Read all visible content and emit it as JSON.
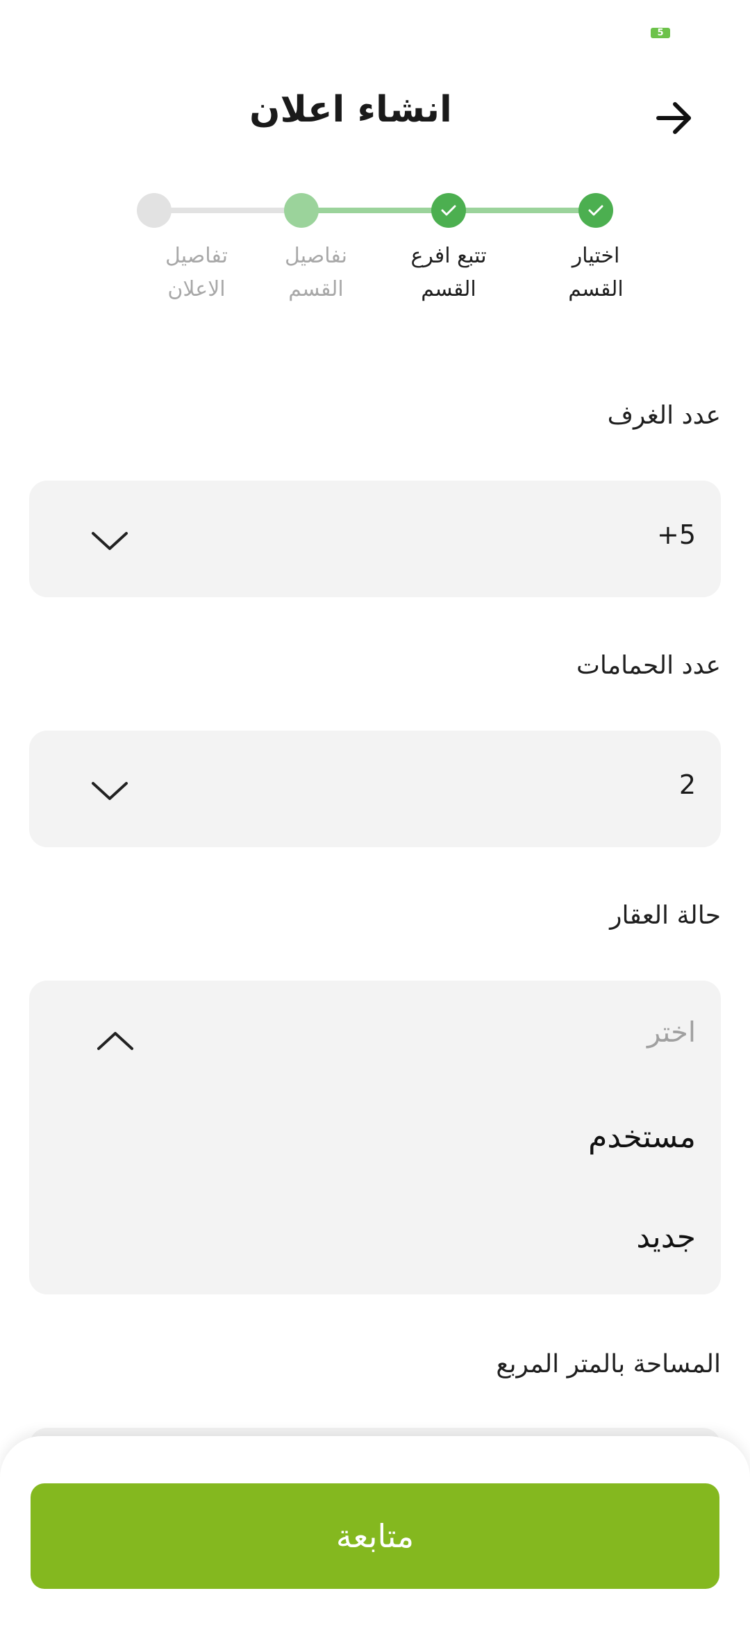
{
  "status_bar": {
    "battery": "5"
  },
  "header": {
    "title": "انشاء اعلان"
  },
  "stepper": {
    "steps": [
      {
        "line1": "اختيار",
        "line2": "القسم",
        "state": "done"
      },
      {
        "line1": "تتبع افرع",
        "line2": "القسم",
        "state": "done"
      },
      {
        "line1": "نفاصيل",
        "line2": "القسم",
        "state": "current"
      },
      {
        "line1": "تفاصيل",
        "line2": "الاعلان",
        "state": "pending"
      }
    ]
  },
  "form": {
    "rooms": {
      "label": "عدد الغرف",
      "value": "5+"
    },
    "bathrooms": {
      "label": "عدد الحمامات",
      "value": "2"
    },
    "condition": {
      "label": "حالة العقار",
      "placeholder": "اختر",
      "options": [
        "مستخدم",
        "جديد"
      ]
    },
    "area": {
      "label": "المساحة بالمتر المربع"
    }
  },
  "footer": {
    "continue_label": "متابعة"
  },
  "colors": {
    "accent": "#84b81f",
    "step_done": "#4caf50",
    "step_current": "#9bd39b",
    "step_pending": "#e2e2e2"
  }
}
